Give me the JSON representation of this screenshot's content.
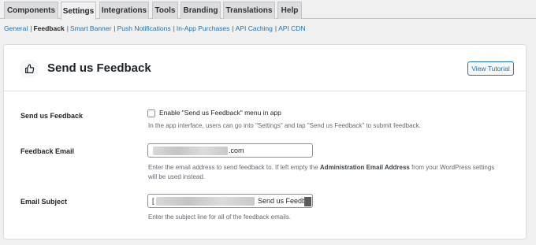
{
  "tabs": [
    {
      "label": "Components",
      "active": false
    },
    {
      "label": "Settings",
      "active": true
    },
    {
      "label": "Integrations",
      "active": false
    },
    {
      "label": "Tools",
      "active": false
    },
    {
      "label": "Branding",
      "active": false
    },
    {
      "label": "Translations",
      "active": false
    },
    {
      "label": "Help",
      "active": false
    }
  ],
  "subnav": [
    {
      "label": "General",
      "current": false
    },
    {
      "label": "Feedback",
      "current": true
    },
    {
      "label": "Smart Banner",
      "current": false
    },
    {
      "label": "Push Notifications",
      "current": false
    },
    {
      "label": "In-App Purchases",
      "current": false
    },
    {
      "label": "API Caching",
      "current": false
    },
    {
      "label": "API CDN",
      "current": false
    }
  ],
  "panel": {
    "icon": "thumbs-up-icon",
    "title": "Send us Feedback",
    "tutorial_button": "View Tutorial"
  },
  "rows": {
    "feedback": {
      "label": "Send us Feedback",
      "checkbox_label": "Enable \"Send us Feedback\" menu in app",
      "checked": false,
      "description": "In the app interface, users can go into \"Settings\" and tap \"Send us Feedback\" to submit feedback."
    },
    "email": {
      "label": "Feedback Email",
      "value_suffix": ".com",
      "desc_1": "Enter the email address to send feedback to. If left empty the ",
      "desc_bold": "Administration Email Address",
      "desc_2": " from your WordPress settings will be used instead."
    },
    "subject": {
      "label": "Email Subject",
      "value_prefix": "[",
      "value_suffix": "Send us Feedb",
      "description": "Enter the subject line for all of the feedback emails."
    }
  },
  "colors": {
    "link": "#2271b1",
    "background": "#f0f0f1",
    "panel": "#ffffff"
  }
}
